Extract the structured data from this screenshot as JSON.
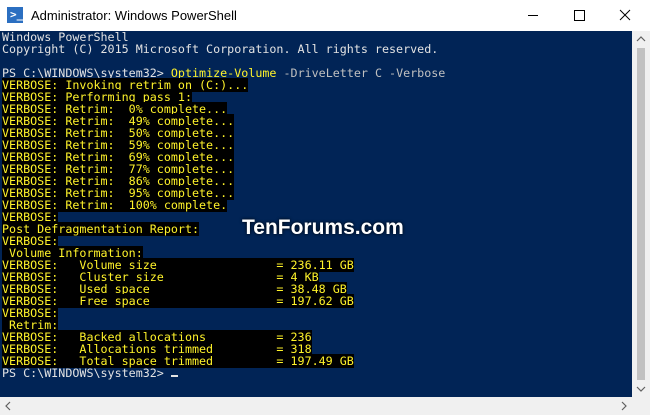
{
  "window": {
    "title": "Administrator: Windows PowerShell",
    "icons": {
      "app": "powershell-icon",
      "minimize": "minimize-icon",
      "maximize": "maximize-icon",
      "close": "close-icon",
      "scroll_up": "chevron-up-icon",
      "scroll_down": "chevron-down-icon",
      "scroll_left": "chevron-left-icon",
      "scroll_right": "chevron-right-icon"
    }
  },
  "colors": {
    "console_background": "#012456",
    "console_text": "#e3e3e3",
    "verbose_text": "#fff32a",
    "verbose_background": "#000000"
  },
  "console": {
    "banner": [
      "Windows PowerShell",
      "Copyright (C) 2015 Microsoft Corporation. All rights reserved."
    ],
    "prompt": "PS C:\\WINDOWS\\system32> ",
    "command": "Optimize-Volume",
    "command_params": " -DriveLetter C -Verbose",
    "output": [
      "VERBOSE: Invoking retrim on (C:)...",
      "VERBOSE: Performing pass 1:",
      "VERBOSE: Retrim:  0% complete...",
      "VERBOSE: Retrim:  49% complete...",
      "VERBOSE: Retrim:  50% complete...",
      "VERBOSE: Retrim:  59% complete...",
      "VERBOSE: Retrim:  69% complete...",
      "VERBOSE: Retrim:  77% complete...",
      "VERBOSE: Retrim:  86% complete...",
      "VERBOSE: Retrim:  95% complete...",
      "VERBOSE: Retrim:  100% complete.",
      "VERBOSE:",
      "Post Defragmentation Report:",
      "VERBOSE:",
      " Volume Information:",
      "VERBOSE:   Volume size                 = 236.11 GB",
      "VERBOSE:   Cluster size                = 4 KB",
      "VERBOSE:   Used space                  = 38.48 GB",
      "VERBOSE:   Free space                  = 197.62 GB",
      "VERBOSE:",
      " Retrim:",
      "VERBOSE:   Backed allocations          = 236",
      "VERBOSE:   Allocations trimmed         = 318",
      "VERBOSE:   Total space trimmed         = 197.49 GB"
    ],
    "final_prompt": "PS C:\\WINDOWS\\system32> "
  },
  "watermark": "TenForums.com"
}
